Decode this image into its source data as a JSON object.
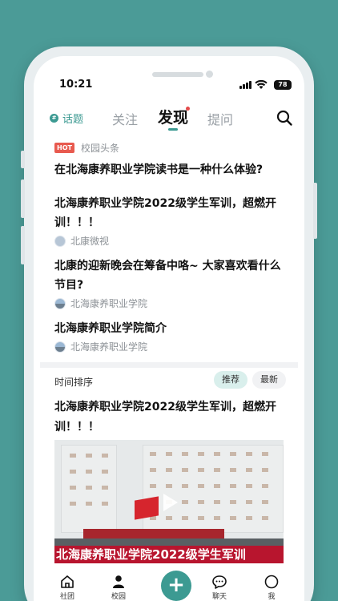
{
  "status_bar": {
    "time": "10:21",
    "battery": "78"
  },
  "top_tabs": {
    "topic_label": "话题",
    "tabs": [
      {
        "label": "关注"
      },
      {
        "label": "发现",
        "active": true
      },
      {
        "label": "提问"
      }
    ]
  },
  "headlines": {
    "badge": "HOT",
    "section_label": "校园头条",
    "items": [
      {
        "title": "在北海康养职业学院读书是一种什么体验?"
      },
      {
        "title": "北海康养职业学院2022级学生军训，超燃开训！！！",
        "source": "北康微视"
      },
      {
        "title": "北康的迎新晚会在筹备中咯~ 大家喜欢看什么节目?",
        "source": "北海康养职业学院"
      },
      {
        "title": "北海康养职业学院简介",
        "source": "北海康养职业学院"
      }
    ]
  },
  "feed": {
    "sort_label": "时间排序",
    "sort_options": [
      "推荐",
      "最新"
    ],
    "post_title": "北海康养职业学院2022级学生军训，超燃开训！！！",
    "video_caption": "北海康养职业学院2022级学生军训"
  },
  "bottom_nav": {
    "items": [
      {
        "label": "社团",
        "icon": "house-icon"
      },
      {
        "label": "校园",
        "icon": "person-icon"
      },
      {
        "label": "",
        "icon": "plus-icon"
      },
      {
        "label": "聊天",
        "icon": "chat-icon"
      },
      {
        "label": "我",
        "icon": "profile-icon"
      }
    ]
  },
  "colors": {
    "brand": "#3c9a92",
    "background": "#4b9b97",
    "hot": "#e85a4f"
  }
}
